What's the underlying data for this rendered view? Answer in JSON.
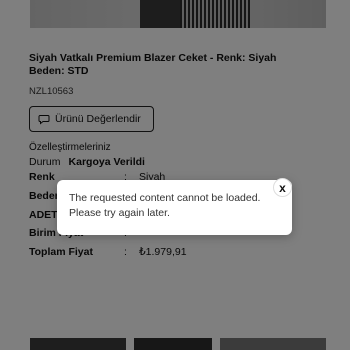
{
  "product": {
    "title": "Siyah Vatkalı Premium Blazer Ceket - Renk: Siyah Beden: STD",
    "code": "NZL10563",
    "review_button_label": "Ürünü Değerlendir"
  },
  "details": {
    "section_title": "Özelleştirmeleriniz",
    "status_label": "Durum",
    "status_value": "Kargoya Verildi",
    "rows": [
      {
        "label": "Renk",
        "sep": ":",
        "value": "Siyah"
      },
      {
        "label": "Beden",
        "sep": ":",
        "value": ""
      },
      {
        "label": "ADET",
        "sep": ":",
        "value": ""
      },
      {
        "label": "Birim Fiyat",
        "sep": ":",
        "value": ""
      },
      {
        "label": "Toplam Fiyat",
        "sep": ":",
        "value": "₺1.979,91"
      }
    ]
  },
  "modal": {
    "message": "The requested content cannot be loaded. Please try again later.",
    "close_label": "x"
  },
  "icons": {
    "review": "chat-bubble-icon"
  }
}
